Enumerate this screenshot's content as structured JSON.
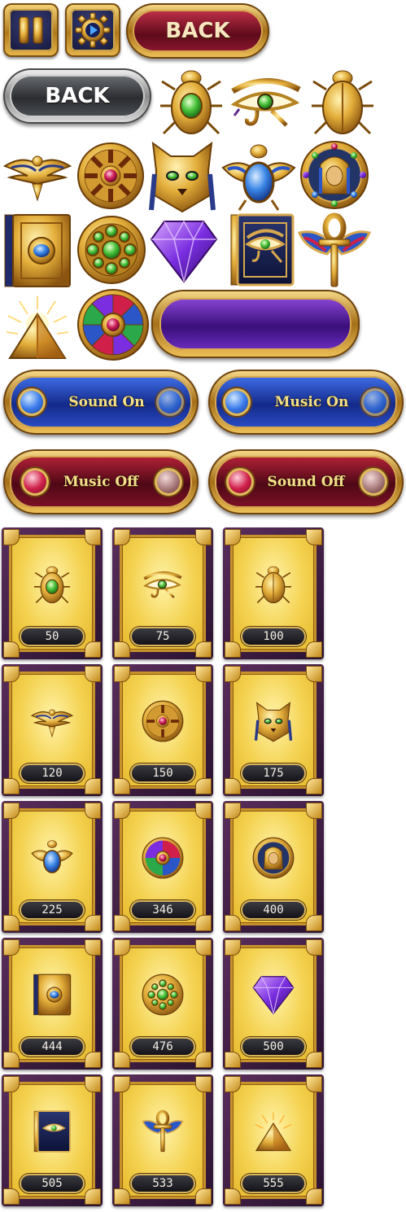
{
  "top_buttons": {
    "pause_icon": "pause-icon",
    "settings_icon": "gear-play-icon",
    "back_red_label": "BACK",
    "back_silver_label": "BACK"
  },
  "toggles": {
    "sound_on": "Sound On",
    "music_on": "Music On",
    "music_off": "Music Off",
    "sound_off": "Sound Off"
  },
  "colors": {
    "gold": "#d7a84e",
    "card_frame": "#5a2e5c",
    "card_panel": "#f4d250",
    "toggle_on": "#2a4dc6",
    "toggle_off": "#7e1226"
  },
  "shop_cards": [
    {
      "icon": "green-scarab-icon",
      "price": "50"
    },
    {
      "icon": "eye-of-horus-icon",
      "price": "75"
    },
    {
      "icon": "gold-scarab-icon",
      "price": "100"
    },
    {
      "icon": "falcon-icon",
      "price": "120"
    },
    {
      "icon": "sun-disc-ruby-icon",
      "price": "150"
    },
    {
      "icon": "cat-bastet-icon",
      "price": "175"
    },
    {
      "icon": "winged-blue-scarab-icon",
      "price": "225"
    },
    {
      "icon": "rainbow-sun-disc-icon",
      "price": "346"
    },
    {
      "icon": "pharaoh-medallion-icon",
      "price": "400"
    },
    {
      "icon": "gold-book-icon",
      "price": "444"
    },
    {
      "icon": "emerald-amulet-icon",
      "price": "476"
    },
    {
      "icon": "purple-diamond-icon",
      "price": "500"
    },
    {
      "icon": "eye-book-icon",
      "price": "505"
    },
    {
      "icon": "winged-ankh-icon",
      "price": "533"
    },
    {
      "icon": "glowing-pyramid-icon",
      "price": "555"
    }
  ]
}
